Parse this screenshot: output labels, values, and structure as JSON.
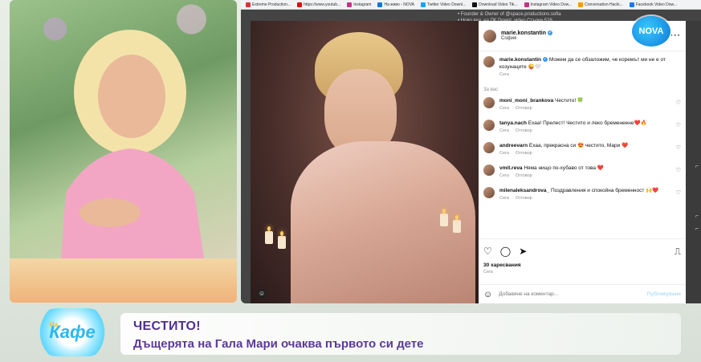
{
  "bookmarks": [
    {
      "label": "Extreme Production...",
      "color": "#d33"
    },
    {
      "label": "https://www.youtub...",
      "color": "#e00"
    },
    {
      "label": "Instagram",
      "color": "#c13584"
    },
    {
      "label": "На живо - NOVA",
      "color": "#0f78d6"
    },
    {
      "label": "Twitter Video Downl...",
      "color": "#1da1f2"
    },
    {
      "label": "Download Video Tik...",
      "color": "#111"
    },
    {
      "label": "Instagram Video Dow...",
      "color": "#c13584"
    },
    {
      "label": "Conversation Hacki...",
      "color": "#f90"
    },
    {
      "label": "Facebook Video Dow...",
      "color": "#1877f2"
    }
  ],
  "web_bg_lines": [
    "• Founder & Owner of @space.productions.sofia",
    "• Ново вкл. на ПК Downl. video Стъпки 528 ..."
  ],
  "instagram": {
    "username": "marie.konstantin",
    "location": "София",
    "caption": "Можем да се обзаложим, че коремът ми не е от козунаците 😜🤍",
    "caption_age": "Сега",
    "section_label": "За вас",
    "comments": [
      {
        "user": "moni_moni_brankova",
        "text": "Честито! 🍀",
        "age": "Сега",
        "reply": "Отговор"
      },
      {
        "user": "tanya.nach",
        "text": "Ехаа! Прелест! Честито и леко бременеене❤️🔥",
        "age": "Сега",
        "reply": "Отговор"
      },
      {
        "user": "andreevarn",
        "text": "Ехаа, прекрасна си 😍 честито, Мари ❤️",
        "age": "Сега",
        "reply": "Отговор"
      },
      {
        "user": "vmit.reva",
        "text": "Няма нищо по-хубаво от това ❤️",
        "age": "Сега",
        "reply": "Отговор"
      },
      {
        "user": "milenaleksandrova_",
        "text": "Поздравления и спокойна бременност 🙌❤️",
        "age": "Сега",
        "reply": "Отговор"
      }
    ],
    "likes": "30 харесвания",
    "date": "Сега",
    "comment_placeholder": "Добавяне на коментар...",
    "publish_label": "Публикуване",
    "accent_color": "#3897f0"
  },
  "channel_logo": "NOVA",
  "lower_third": {
    "headline": "ЧЕСТИТО!",
    "subheadline": "Дъщерята на Гала Мари очаква първото си дете",
    "show_logo": "Кафе",
    "show_logo_prefix": "На",
    "headline_color": "#4f2f90"
  }
}
